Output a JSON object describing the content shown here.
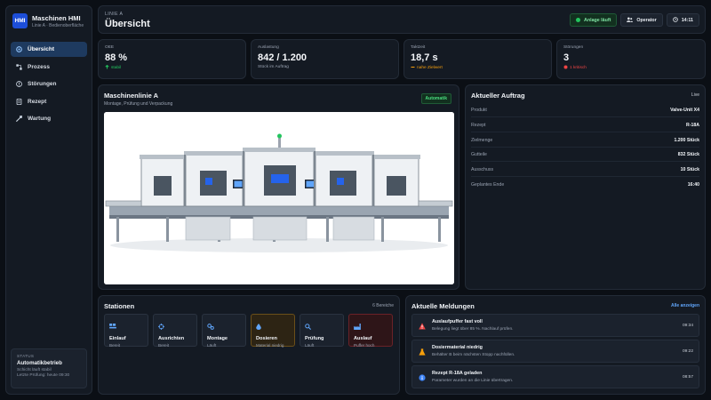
{
  "app": {
    "title": "Maschinen HMI",
    "subtitle": "Linie A · Bedienoberfläche",
    "logo_text": "HMI"
  },
  "sidebar": {
    "items": [
      {
        "label": "Übersicht",
        "icon": "dashboard-icon",
        "active": true
      },
      {
        "label": "Prozess",
        "icon": "process-icon",
        "active": false
      },
      {
        "label": "Störungen",
        "icon": "alert-icon",
        "active": false
      },
      {
        "label": "Rezept",
        "icon": "recipe-icon",
        "active": false
      },
      {
        "label": "Wartung",
        "icon": "wrench-icon",
        "active": false
      }
    ],
    "status": {
      "heading": "STATUS",
      "title": "Automatikbetrieb",
      "line1": "Schicht läuft stabil",
      "line2": "Letzte Prüfung: heute 09:30"
    }
  },
  "header": {
    "breadcrumb": "LINIE A",
    "title": "Übersicht",
    "plant_status": "Anlage läuft",
    "user": "Operator",
    "time": "14:11"
  },
  "kpis": [
    {
      "label": "OEE",
      "value": "88 %",
      "sub": "stabil",
      "sub_color": "#22c55e",
      "icon": "arrow-up-icon"
    },
    {
      "label": "Auslastung",
      "value": "842 / 1.200",
      "sub": "Stück im Auftrag",
      "sub_color": "#9aa3b2",
      "icon": ""
    },
    {
      "label": "Taktzeit",
      "value": "18,7 s",
      "sub": "nahe Zielwert",
      "sub_color": "#f59e0b",
      "icon": "dash-icon"
    },
    {
      "label": "Störungen",
      "value": "3",
      "sub": "1 kritisch",
      "sub_color": "#ef4444",
      "icon": "critical-dot-icon"
    }
  ],
  "machine": {
    "title": "Maschinenlinie A",
    "subtitle": "Montage, Prüfung und Verpackung",
    "mode": "Automatik"
  },
  "order": {
    "title": "Aktueller Auftrag",
    "badge": "Live",
    "rows": [
      {
        "key": "Produkt",
        "value": "Valve-Unit X4"
      },
      {
        "key": "Rezept",
        "value": "R-18A"
      },
      {
        "key": "Zielmenge",
        "value": "1.200 Stück"
      },
      {
        "key": "Gutteile",
        "value": "832 Stück"
      },
      {
        "key": "Ausschuss",
        "value": "10 Stück"
      },
      {
        "key": "Geplantes Ende",
        "value": "16:40"
      }
    ]
  },
  "stations": {
    "title": "Stationen",
    "count": "6 Bereiche",
    "items": [
      {
        "name": "Einlauf",
        "state": "Bereit",
        "icon": "conveyor-icon",
        "level": "normal"
      },
      {
        "name": "Ausrichten",
        "state": "Bereit",
        "icon": "crosshair-icon",
        "level": "normal"
      },
      {
        "name": "Montage",
        "state": "Läuft",
        "icon": "gears-icon",
        "level": "normal"
      },
      {
        "name": "Dosieren",
        "state": "Material niedrig",
        "icon": "droplet-icon",
        "level": "warn"
      },
      {
        "name": "Prüfung",
        "state": "Läuft",
        "icon": "magnifier-icon",
        "level": "normal"
      },
      {
        "name": "Auslauf",
        "state": "Puffer hoch",
        "icon": "factory-icon",
        "level": "err"
      }
    ]
  },
  "messages": {
    "title": "Aktuelle Meldungen",
    "link": "Alle anzeigen",
    "items": [
      {
        "title": "Auslaufpuffer fast voll",
        "detail": "Belegung liegt über 85 %. Nachlauf prüfen.",
        "time": "09:34",
        "icon": "warning-triangle-icon",
        "color": "#ef4444"
      },
      {
        "title": "Dosiermaterial niedrig",
        "detail": "Behälter B beim nächsten Stopp nachfüllen.",
        "time": "09:22",
        "icon": "flask-icon",
        "color": "#f59e0b"
      },
      {
        "title": "Rezept R-18A geladen",
        "detail": "Parameter wurden an die Linie übertragen.",
        "time": "08:57",
        "icon": "info-icon",
        "color": "#3b82f6"
      }
    ]
  },
  "colors": {
    "accent": "#3b82f6",
    "ok": "#22c55e",
    "warn": "#f59e0b",
    "error": "#ef4444"
  }
}
